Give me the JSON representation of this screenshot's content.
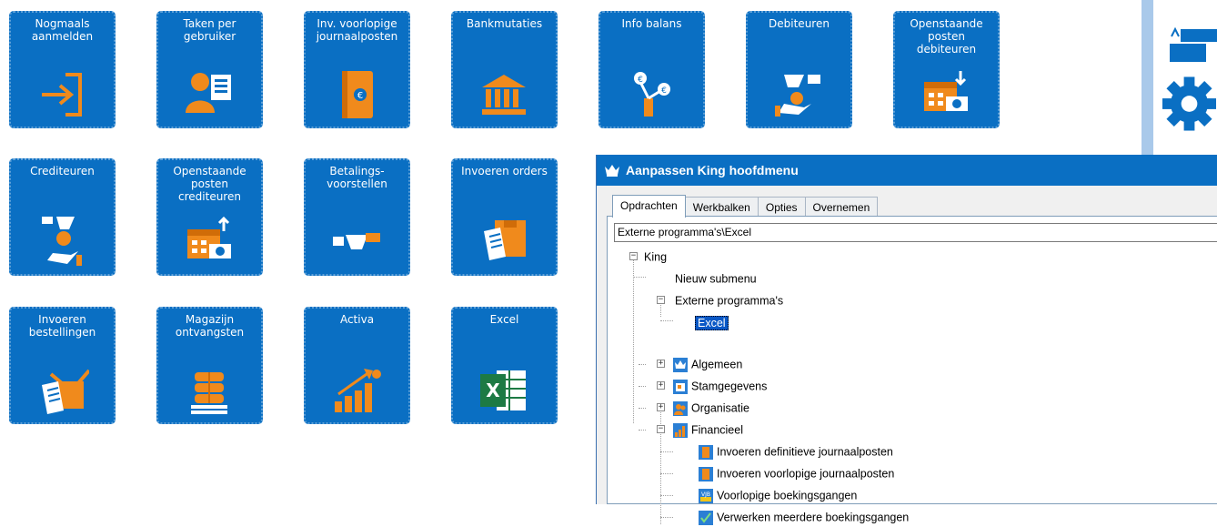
{
  "tiles": [
    {
      "label": "Nogmaals\naanmelden",
      "icon": "login-arrow-icon"
    },
    {
      "label": "Taken per\ngebruiker",
      "icon": "user-tasks-icon"
    },
    {
      "label": "Inv. voorlopige\njournaalposten",
      "icon": "journal-book-icon"
    },
    {
      "label": "Bankmutaties",
      "icon": "bank-icon"
    },
    {
      "label": "Info balans",
      "icon": "balance-info-icon"
    },
    {
      "label": "Debiteuren",
      "icon": "debtors-icon"
    },
    {
      "label": "Openstaande\nposten debiteuren",
      "icon": "calendar-money-in-icon"
    },
    {
      "label": "Crediteuren",
      "icon": "creditors-icon"
    },
    {
      "label": "Openstaande\nposten crediteuren",
      "icon": "calendar-money-out-icon"
    },
    {
      "label": "Betalings-\nvoorstellen",
      "icon": "payment-proposal-icon"
    },
    {
      "label": "Invoeren orders",
      "icon": "order-entry-icon"
    },
    {
      "label": "Invoeren\nbestellingen",
      "icon": "purchase-entry-icon"
    },
    {
      "label": "Magazijn\nontvangsten",
      "icon": "warehouse-pallet-icon"
    },
    {
      "label": "Activa",
      "icon": "assets-growth-icon"
    },
    {
      "label": "Excel",
      "icon": "excel-icon"
    }
  ],
  "dialog": {
    "title": "Aanpassen King hoofdmenu",
    "tabs": [
      "Opdrachten",
      "Werkbalken",
      "Opties",
      "Overnemen"
    ],
    "active_tab": "Opdrachten",
    "path": "Externe programma's\\Excel",
    "tree": {
      "root": "King",
      "nieuw": "Nieuw submenu",
      "externe": "Externe programma's",
      "excel": "Excel",
      "algemeen": "Algemeen",
      "stamgegevens": "Stamgegevens",
      "organisatie": "Organisatie",
      "financieel": "Financieel",
      "fin1": "Invoeren definitieve journaalposten",
      "fin2": "Invoeren voorlopige journaalposten",
      "fin3": "Voorlopige boekingsgangen",
      "fin4": "Verwerken meerdere boekingsgangen"
    }
  },
  "colors": {
    "tile": "#0a6fc3",
    "accent": "#f08a1c",
    "title": "#0a6fc3",
    "selection": "#0a58c6"
  }
}
